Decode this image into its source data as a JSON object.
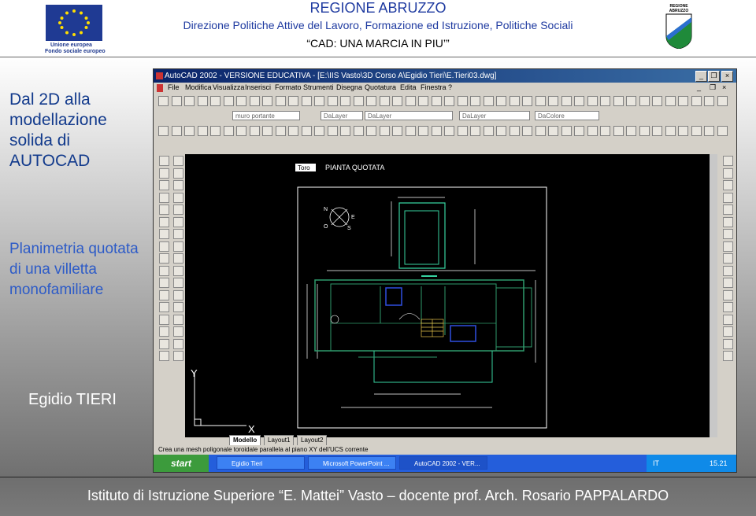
{
  "header": {
    "title": "REGIONE ABRUZZO",
    "subtitle": "Direzione Politiche Attive del Lavoro, Formazione ed Istruzione, Politiche Sociali",
    "project": "“CAD: UNA MARCIA IN PIU’”",
    "eu_caption_1": "Unione europea",
    "eu_caption_2": "Fondo sociale europeo",
    "region_logo_text": "REGIONE ABRUZZO"
  },
  "left_panel": {
    "title_lines": [
      "Dal 2D alla",
      "modellazione",
      "solida di",
      "AUTOCAD"
    ],
    "subtitle_lines": [
      "Planimetria quotata",
      "di una villetta",
      "monofamiliare"
    ],
    "author": "Egidio TIERI"
  },
  "footer": {
    "text": "Istituto di Istruzione Superiore “E. Mattei” Vasto – docente prof. Arch. Rosario PAPPALARDO"
  },
  "screenshot": {
    "window_title": "AutoCAD 2002 - VERSIONE EDUCATIVA - [E:\\IIS Vasto\\3D Corso A\\Egidio Tieri\\E.Tieri03.dwg]",
    "menus": [
      "File",
      "Modifica",
      "Visualizza",
      "Inserisci",
      "Formato",
      "Strumenti",
      "Disegna",
      "Quotatura",
      "Edita",
      "Finestra",
      "?"
    ],
    "layer_combo": "muro portante",
    "layer_combo_2": "DaLayer",
    "linetype_combo": "DaLayer",
    "lineweight_combo": "DaLayer",
    "color_combo": "DaColore",
    "drawing_label": "Toro",
    "drawing_title": "PIANTA QUOTATA",
    "compass": {
      "n": "N",
      "e": "E",
      "o": "O",
      "s": "S"
    },
    "ucs": {
      "y": "Y",
      "x": "X"
    },
    "tabs": [
      {
        "label": "Modello",
        "active": true
      },
      {
        "label": "Layout1",
        "active": false
      },
      {
        "label": "Layout2",
        "active": false
      }
    ],
    "command_line": "Crea una mesh poligonale toroidale parallela al piano XY dell'UCS corrente",
    "taskbar": {
      "start": "start",
      "buttons": [
        {
          "label": "Egidio Tieri",
          "active": false
        },
        {
          "label": "Microsoft PowerPoint ...",
          "active": false
        },
        {
          "label": "AutoCAD 2002 - VER...",
          "active": true
        }
      ],
      "lang": "IT",
      "clock": "15.21"
    }
  }
}
